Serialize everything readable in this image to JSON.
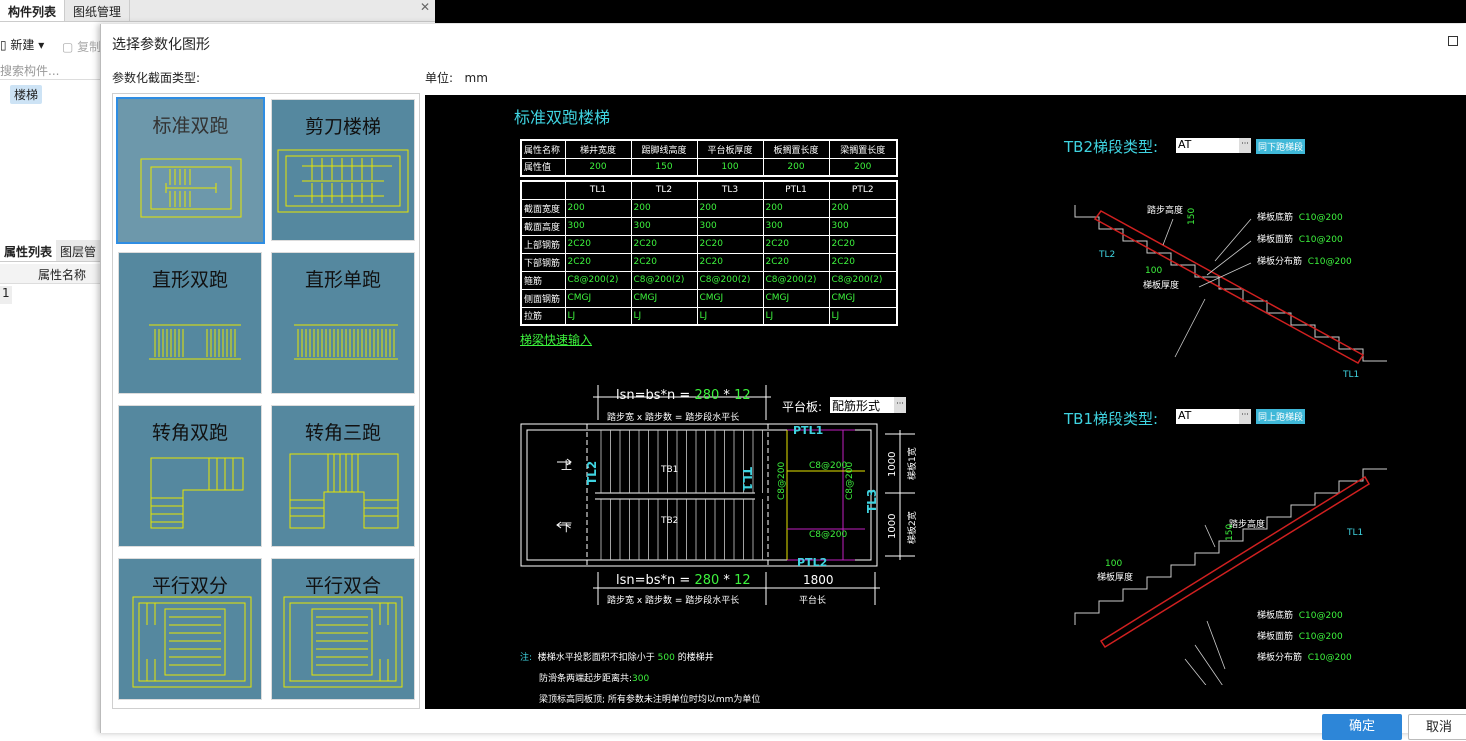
{
  "bg": {
    "tab1": "构件列表",
    "tab2": "图纸管理",
    "new": "新建",
    "copy": "复制",
    "search": "搜索构件...",
    "item": "楼梯",
    "tab3": "属性列表",
    "tab4": "图层管",
    "col": "属性名称",
    "row1": "1"
  },
  "dialog": {
    "title": "选择参数化图形",
    "type_label": "参数化截面类型:",
    "unit_label": "单位:",
    "unit": "mm",
    "ok": "确定",
    "cancel": "取消"
  },
  "tiles": [
    "标准双跑",
    "剪刀楼梯",
    "直形双跑",
    "直形单跑",
    "转角双跑",
    "转角三跑",
    "平行双分",
    "平行双合"
  ],
  "drawing": {
    "title": "标准双跑楼梯",
    "prop_headers": [
      "属性名称",
      "梯井宽度",
      "踢脚线高度",
      "平台板厚度",
      "板搁置长度",
      "梁搁置长度"
    ],
    "prop_values": [
      "属性值",
      "200",
      "150",
      "100",
      "200",
      "200"
    ],
    "beam_headers": [
      "",
      "TL1",
      "TL2",
      "TL3",
      "PTL1",
      "PTL2"
    ],
    "beam_rows": [
      [
        "截面宽度",
        "200",
        "200",
        "200",
        "200",
        "200"
      ],
      [
        "截面高度",
        "300",
        "300",
        "300",
        "300",
        "300"
      ],
      [
        "上部钢筋",
        "2C20",
        "2C20",
        "2C20",
        "2C20",
        "2C20"
      ],
      [
        "下部钢筋",
        "2C20",
        "2C20",
        "2C20",
        "2C20",
        "2C20"
      ],
      [
        "箍筋",
        "C8@200(2)",
        "C8@200(2)",
        "C8@200(2)",
        "C8@200(2)",
        "C8@200(2)"
      ],
      [
        "侧面钢筋",
        "CMGJ",
        "CMGJ",
        "CMGJ",
        "CMGJ",
        "CMGJ"
      ],
      [
        "拉筋",
        "LJ",
        "LJ",
        "LJ",
        "LJ",
        "LJ"
      ]
    ],
    "quick": "梯梁快速输入",
    "formula": "lsn=bs*n =",
    "f1": "280",
    "fx": "*",
    "f2": "12",
    "formula_sub": "踏步宽 x 踏步数 = 踏步段水平长",
    "plat_label": "平台板:",
    "plat_value": "配筋形式",
    "up": "上",
    "down": "下",
    "tb1": "TB1",
    "tb2": "TB2",
    "tl1": "TL1",
    "tl2": "TL2",
    "tl3": "TL3",
    "ptl1": "PTL1",
    "ptl2": "PTL2",
    "c8": "C8@200",
    "d1000a": "1000",
    "d1000b": "1000",
    "w1": "梯板1宽",
    "w2": "梯板2宽",
    "len1800": "1800",
    "plat_len": "平台长",
    "note_lbl": "注:",
    "note1a": "楼梯水平投影面积不扣除小于",
    "note1v": "500",
    "note1b": "的楼梯井",
    "note2a": "防滑条两端起步距离共:",
    "note2v": "300",
    "note3": "梁顶标高同板顶; 所有参数未注明单位时均以mm为单位",
    "tb2_label": "TB2梯段类型:",
    "tb2_val": "AT",
    "tb2_btn": "同下跑梯段",
    "tb1_label": "TB1梯段类型:",
    "tb1_val": "AT",
    "tb1_btn": "同上跑梯段",
    "step_h": "踏步高度",
    "slab_t": "梯板厚度",
    "v150": "150",
    "v100": "100",
    "bot": "梯板底筋",
    "top": "梯板面筋",
    "dist": "梯板分布筋",
    "rebar": "C10@200"
  }
}
